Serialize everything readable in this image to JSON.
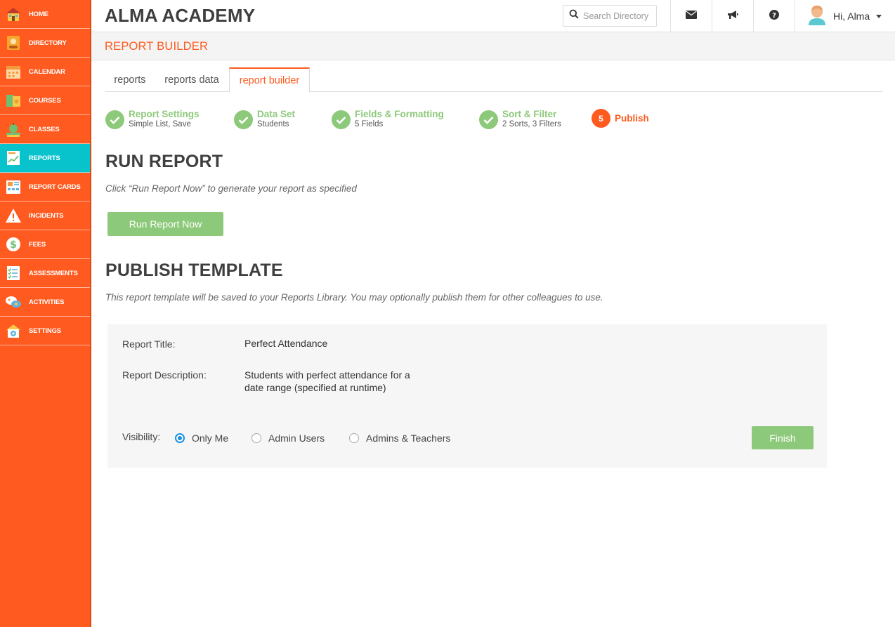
{
  "sidebar": {
    "items": [
      {
        "label": "HOME",
        "icon": "school-house-icon"
      },
      {
        "label": "DIRECTORY",
        "icon": "contact-card-icon"
      },
      {
        "label": "CALENDAR",
        "icon": "calendar-icon"
      },
      {
        "label": "COURSES",
        "icon": "courses-book-icon"
      },
      {
        "label": "CLASSES",
        "icon": "apple-books-icon"
      },
      {
        "label": "REPORTS",
        "icon": "report-chart-icon"
      },
      {
        "label": "REPORT CARDS",
        "icon": "report-card-icon"
      },
      {
        "label": "INCIDENTS",
        "icon": "warning-icon"
      },
      {
        "label": "FEES",
        "icon": "dollar-icon"
      },
      {
        "label": "ASSESSMENTS",
        "icon": "checklist-icon"
      },
      {
        "label": "ACTIVITIES",
        "icon": "activities-icon"
      },
      {
        "label": "SETTINGS",
        "icon": "settings-gear-icon"
      }
    ],
    "active_index": 5
  },
  "header": {
    "title": "ALMA ACADEMY",
    "search_placeholder": "Search Directory",
    "user_greeting": "Hi, Alma"
  },
  "page": {
    "title": "REPORT BUILDER"
  },
  "tabs": [
    {
      "label": "reports"
    },
    {
      "label": "reports data"
    },
    {
      "label": "report builder"
    }
  ],
  "steps": [
    {
      "title": "Report Settings",
      "subtitle": "Simple List, Save"
    },
    {
      "title": "Data Set",
      "subtitle": "Students"
    },
    {
      "title": "Fields & Formatting",
      "subtitle": "5 Fields"
    },
    {
      "title": "Sort & Filter",
      "subtitle": "2 Sorts, 3 Filters"
    },
    {
      "number": "5",
      "title": "Publish"
    }
  ],
  "run_report": {
    "heading": "RUN REPORT",
    "description": "Click “Run Report Now” to generate your report as specified",
    "button": "Run Report Now"
  },
  "publish": {
    "heading": "PUBLISH TEMPLATE",
    "description": "This report template will be saved to your Reports Library. You may optionally publish them for other colleagues to use.",
    "title_label": "Report Title:",
    "title_value": "Perfect Attendance",
    "description_label": "Report Description:",
    "description_value_line1": "Students with perfect attendance for a",
    "description_value_line2": "date range (specified at runtime)",
    "visibility_label": "Visibility:",
    "visibility_options": [
      "Only Me",
      "Admin Users",
      "Admins & Teachers"
    ],
    "finish_button": "Finish"
  },
  "colors": {
    "brand_orange": "#ff5a1f",
    "active_teal": "#08c2cc",
    "step_green": "#8dc97a",
    "radio_blue": "#1a8fe0"
  }
}
